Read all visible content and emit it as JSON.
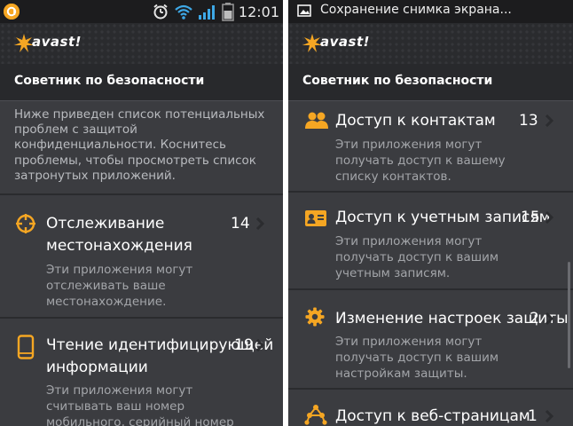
{
  "left": {
    "status_time": "12:01",
    "app_name": "avast!",
    "title": "Советник по безопасности",
    "intro": "Ниже приведен список потенциальных проблем с защитой конфиденциальности. Коснитесь проблемы, чтобы просмотреть список затронутых приложений.",
    "items": [
      {
        "title_lines": [
          "Отслеживание",
          "местонахождения"
        ],
        "count": "14",
        "desc_lines": [
          "Эти приложения могут",
          "отслеживать ваше",
          "местонахождение."
        ],
        "icon": "crosshair-icon"
      },
      {
        "title_lines": [
          "Чтение идентифицирующей",
          "информации"
        ],
        "count": "19",
        "desc_lines": [
          "Эти приложения могут",
          "считывать ваш номер",
          "мобильного, серийный номер"
        ],
        "icon": "phone-icon"
      }
    ]
  },
  "right": {
    "notification": "Сохранение снимка экрана...",
    "app_name": "avast!",
    "title": "Советник по безопасности",
    "items": [
      {
        "title_lines": [
          "Доступ к контактам"
        ],
        "count": "13",
        "desc_lines": [
          "Эти приложения могут",
          "получать доступ к вашему",
          "списку контактов."
        ],
        "icon": "contacts-icon"
      },
      {
        "title_lines": [
          "Доступ к учетным записям"
        ],
        "count": "15",
        "desc_lines": [
          "Эти приложения могут",
          "получать доступ к вашим",
          "учетным записям."
        ],
        "icon": "id-card-icon"
      },
      {
        "title_lines": [
          "Изменение настроек защиты"
        ],
        "count": "2",
        "desc_lines": [
          "Эти приложения могут",
          "получать доступ к вашим",
          "настройкам защиты."
        ],
        "icon": "gear-icon"
      },
      {
        "title_lines": [
          "Доступ к веб-страницам"
        ],
        "count": "1",
        "desc_lines": [],
        "icon": "web-nodes-icon"
      }
    ]
  },
  "colors": {
    "accent": "#f5a623",
    "background": "#3b3c40",
    "statusbar": "#1c1c1e",
    "signal": "#3ea8e6"
  }
}
